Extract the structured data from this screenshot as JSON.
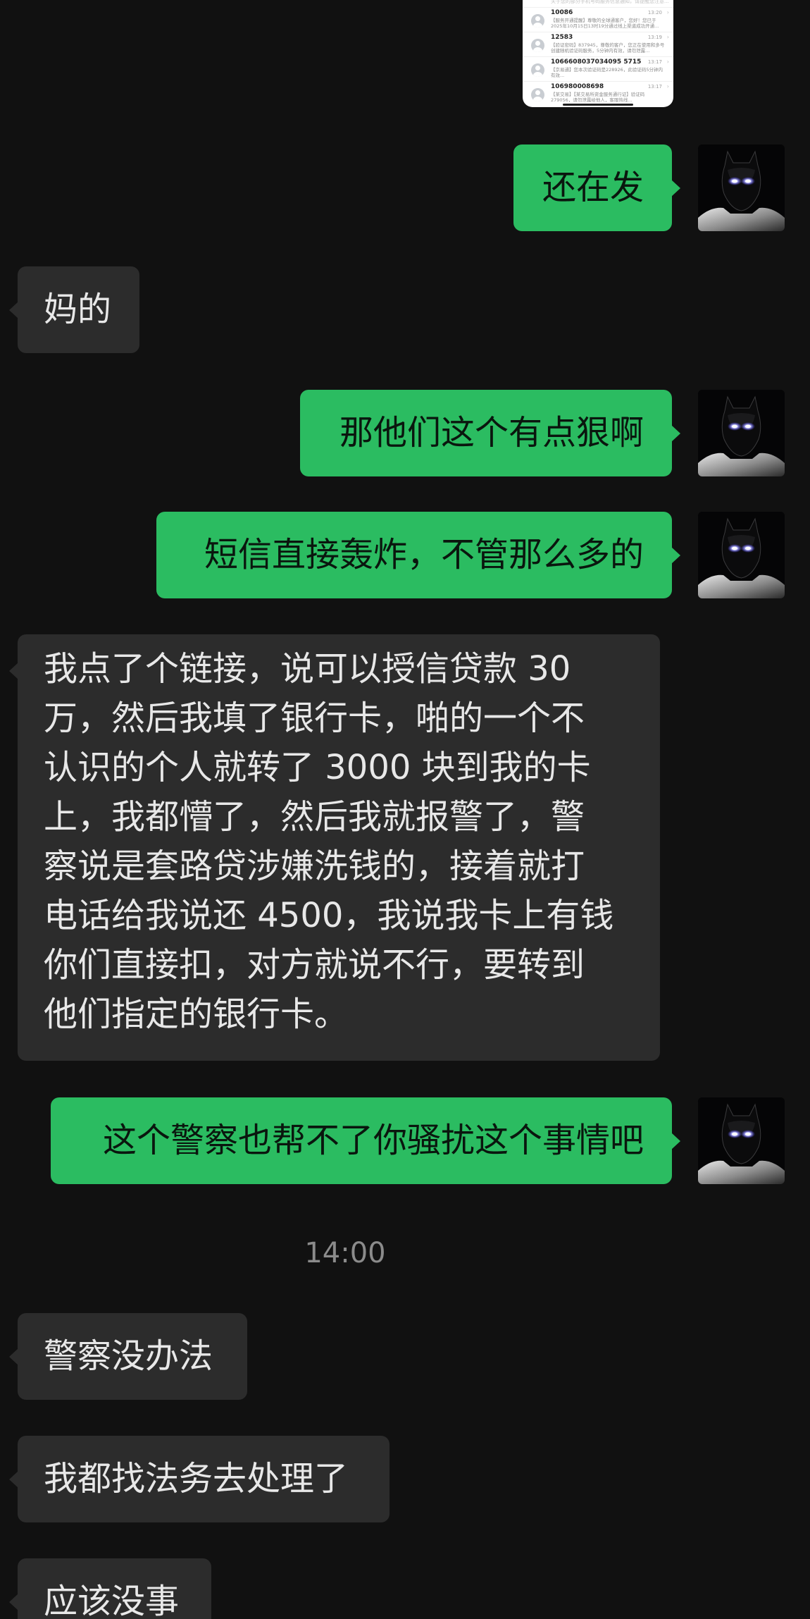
{
  "shared_screenshot": {
    "peek_text": "关于您的部分手机号码服务信息通知，请提醒您注意...",
    "rows": [
      {
        "name": "10086",
        "time": "13:20",
        "snippet": "【服务开通提醒】尊敬的全球通客户，您好！您已于2025年10月15日13时19分通过线上渠道成功开通..."
      },
      {
        "name": "12583",
        "time": "13:19",
        "snippet": "【验证密码】837945，尊敬的客户，您正在使用和多号创建随机验证码服务，5分钟内有效，请勿泄露..."
      },
      {
        "name": "1066608037034095 5715",
        "time": "13:17",
        "snippet": "【京易通】您本次验证码是228926，此验证码5分钟内有效..."
      },
      {
        "name": "106980008698",
        "time": "13:17",
        "snippet": "【某交易】【某交易所资金服务通行证】验证码279056，请勿泄露给他人，客服热线..."
      }
    ]
  },
  "messages": [
    {
      "id": "m1",
      "side": "out",
      "text": "还在发"
    },
    {
      "id": "m2",
      "side": "in",
      "text": "妈的"
    },
    {
      "id": "m3",
      "side": "out",
      "text": "那他们这个有点狠啊"
    },
    {
      "id": "m4",
      "side": "out",
      "text": "短信直接轰炸，不管那么多的"
    },
    {
      "id": "m5",
      "side": "in",
      "lines": [
        "我点了个链接，说可以授信贷款 30",
        "万，然后我填了银行卡，啪的一个不",
        "认识的个人就转了 3000 块到我的卡",
        "上，我都懵了，然后我就报警了，警",
        "察说是套路贷涉嫌洗钱的，接着就打",
        "电话给我说还 4500，我说我卡上有钱",
        "你们直接扣，对方就说不行，要转到",
        "他们指定的银行卡。"
      ]
    },
    {
      "id": "m6",
      "side": "out",
      "text": "这个警察也帮不了你骚扰这个事情吧"
    },
    {
      "id": "m7",
      "side": "in",
      "text": "警察没办法"
    },
    {
      "id": "m8",
      "side": "in",
      "text": "我都找法务去处理了"
    },
    {
      "id": "m9",
      "side": "in",
      "text": "应该没事"
    }
  ],
  "timestamp": "14:00",
  "colors": {
    "background": "#111111",
    "bubble_out": "#2BBC61",
    "bubble_in": "#2C2C2C",
    "timestamp": "#8B8B8B"
  },
  "icons": {
    "self_avatar": "batman-avatar-icon",
    "sms_contact": "contact-avatar-icon"
  }
}
